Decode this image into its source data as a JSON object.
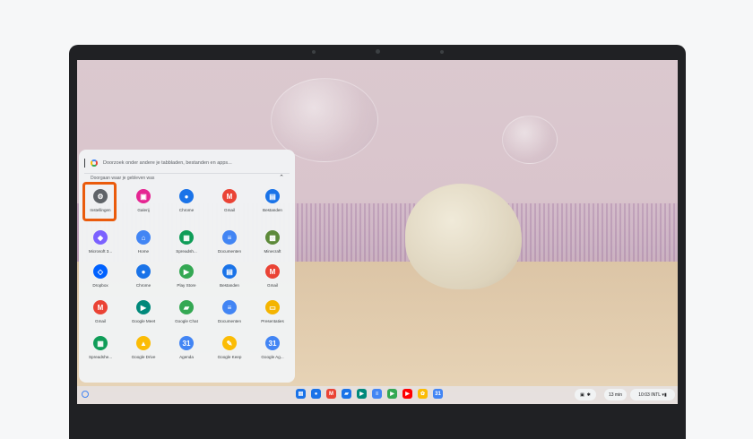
{
  "search": {
    "placeholder": "Doorzoek onder andere je tabbladen, bestanden en apps..."
  },
  "continue": {
    "label": "Doorgaan waar je gebleven was"
  },
  "apps": [
    [
      {
        "label": "Instellingen",
        "color": "#5f6368",
        "glyph": "⚙",
        "icon": "settings-icon"
      },
      {
        "label": "Galerij",
        "color": "#e52592",
        "glyph": "▣",
        "icon": "gallery-icon"
      },
      {
        "label": "Chrome",
        "color": "#1a73e8",
        "glyph": "●",
        "icon": "chrome-icon"
      },
      {
        "label": "Gmail",
        "color": "#ea4335",
        "glyph": "M",
        "icon": "gmail-icon"
      },
      {
        "label": "Bestanden",
        "color": "#1a73e8",
        "glyph": "▤",
        "icon": "files-icon"
      }
    ],
    [
      {
        "label": "Microsoft 3...",
        "color": "#7b61ff",
        "glyph": "◆",
        "icon": "microsoft365-icon"
      },
      {
        "label": "Home",
        "color": "#4285f4",
        "glyph": "⌂",
        "icon": "home-icon"
      },
      {
        "label": "Spreadsh...",
        "color": "#0f9d58",
        "glyph": "▦",
        "icon": "sheets-icon"
      },
      {
        "label": "Documenten",
        "color": "#4285f4",
        "glyph": "≡",
        "icon": "docs-icon"
      },
      {
        "label": "Minecraft",
        "color": "#5d8a3a",
        "glyph": "▩",
        "icon": "minecraft-icon"
      }
    ],
    [
      {
        "label": "Dropbox",
        "color": "#0061ff",
        "glyph": "◇",
        "icon": "dropbox-icon"
      },
      {
        "label": "Chrome",
        "color": "#1a73e8",
        "glyph": "●",
        "icon": "chrome-icon"
      },
      {
        "label": "Play Store",
        "color": "#34a853",
        "glyph": "▶",
        "icon": "play-store-icon"
      },
      {
        "label": "Bestanden",
        "color": "#1a73e8",
        "glyph": "▤",
        "icon": "files-icon"
      },
      {
        "label": "Gmail",
        "color": "#ea4335",
        "glyph": "M",
        "icon": "gmail-icon"
      }
    ],
    [
      {
        "label": "Gmail",
        "color": "#ea4335",
        "glyph": "M",
        "icon": "gmail-icon"
      },
      {
        "label": "Google Meet",
        "color": "#00897b",
        "glyph": "▶",
        "icon": "meet-icon"
      },
      {
        "label": "Google Chat",
        "color": "#34a853",
        "glyph": "▰",
        "icon": "chat-icon"
      },
      {
        "label": "Documenten",
        "color": "#4285f4",
        "glyph": "≡",
        "icon": "docs-icon"
      },
      {
        "label": "Presentaties",
        "color": "#f4b400",
        "glyph": "▭",
        "icon": "slides-icon"
      }
    ],
    [
      {
        "label": "Spreadshe...",
        "color": "#0f9d58",
        "glyph": "▦",
        "icon": "sheets-icon"
      },
      {
        "label": "Google Drive",
        "color": "#fbbc05",
        "glyph": "▲",
        "icon": "drive-icon"
      },
      {
        "label": "Agenda",
        "color": "#4285f4",
        "glyph": "31",
        "icon": "calendar-icon"
      },
      {
        "label": "Google Keep",
        "color": "#fbbc05",
        "glyph": "✎",
        "icon": "keep-icon"
      },
      {
        "label": "Google Ag...",
        "color": "#4285f4",
        "glyph": "31",
        "icon": "calendar-icon"
      }
    ]
  ],
  "shelf": {
    "pinned": [
      {
        "icon": "files-icon",
        "color": "#1a73e8",
        "glyph": "▤"
      },
      {
        "icon": "chrome-icon",
        "color": "#1a73e8",
        "glyph": "●"
      },
      {
        "icon": "gmail-icon",
        "color": "#ea4335",
        "glyph": "M"
      },
      {
        "icon": "chat-icon",
        "color": "#1a73e8",
        "glyph": "▰"
      },
      {
        "icon": "meet-icon",
        "color": "#00897b",
        "glyph": "▶"
      },
      {
        "icon": "docs-icon",
        "color": "#4285f4",
        "glyph": "≡"
      },
      {
        "icon": "play-store-icon",
        "color": "#34a853",
        "glyph": "▶"
      },
      {
        "icon": "youtube-icon",
        "color": "#ff0000",
        "glyph": "▶"
      },
      {
        "icon": "photos-icon",
        "color": "#fbbc05",
        "glyph": "✿"
      },
      {
        "icon": "calendar-icon",
        "color": "#4285f4",
        "glyph": "31"
      }
    ],
    "timer": "13 min",
    "clock": "10:03",
    "locale": "INTL"
  }
}
